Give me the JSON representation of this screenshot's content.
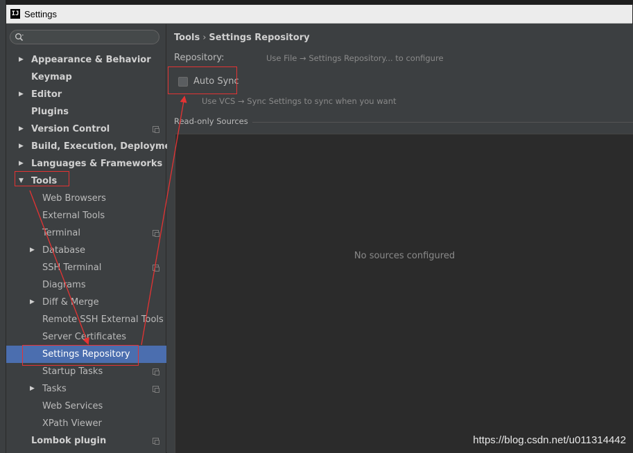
{
  "window": {
    "title": "Settings",
    "app_icon_text": "IJ"
  },
  "search": {
    "placeholder": ""
  },
  "sidebar": {
    "items": [
      {
        "label": "Appearance & Behavior",
        "level": "top",
        "arrow": "right"
      },
      {
        "label": "Keymap",
        "level": "top"
      },
      {
        "label": "Editor",
        "level": "top",
        "arrow": "right"
      },
      {
        "label": "Plugins",
        "level": "top"
      },
      {
        "label": "Version Control",
        "level": "top",
        "arrow": "right",
        "project_icon": true
      },
      {
        "label": "Build, Execution, Deployment",
        "level": "top",
        "arrow": "right"
      },
      {
        "label": "Languages & Frameworks",
        "level": "top",
        "arrow": "right"
      },
      {
        "label": "Tools",
        "level": "top",
        "arrow": "down"
      },
      {
        "label": "Web Browsers",
        "level": "child"
      },
      {
        "label": "External Tools",
        "level": "child"
      },
      {
        "label": "Terminal",
        "level": "child",
        "project_icon": true
      },
      {
        "label": "Database",
        "level": "child",
        "arrow": "right"
      },
      {
        "label": "SSH Terminal",
        "level": "child",
        "project_icon": true
      },
      {
        "label": "Diagrams",
        "level": "child"
      },
      {
        "label": "Diff & Merge",
        "level": "child",
        "arrow": "right"
      },
      {
        "label": "Remote SSH External Tools",
        "level": "child"
      },
      {
        "label": "Server Certificates",
        "level": "child"
      },
      {
        "label": "Settings Repository",
        "level": "child",
        "selected": true
      },
      {
        "label": "Startup Tasks",
        "level": "child",
        "project_icon": true
      },
      {
        "label": "Tasks",
        "level": "child",
        "arrow": "right",
        "project_icon": true
      },
      {
        "label": "Web Services",
        "level": "child"
      },
      {
        "label": "XPath Viewer",
        "level": "child"
      },
      {
        "label": "Lombok plugin",
        "level": "top",
        "project_icon": true
      }
    ]
  },
  "content": {
    "breadcrumb_parent": "Tools",
    "breadcrumb_sep": "›",
    "breadcrumb_current": "Settings Repository",
    "repository_label": "Repository:",
    "repository_hint": "Use File → Settings Repository... to configure",
    "auto_sync_label": "Auto Sync",
    "auto_sync_checked": false,
    "auto_sync_hint": "Use VCS → Sync Settings to sync when you want",
    "readonly_title": "Read-only Sources",
    "no_sources": "No sources configured"
  },
  "watermark": "https://blog.csdn.net/u011314442",
  "colors": {
    "selection": "#4b6eaf",
    "annotation": "#e53333",
    "background": "#3c3f41"
  }
}
